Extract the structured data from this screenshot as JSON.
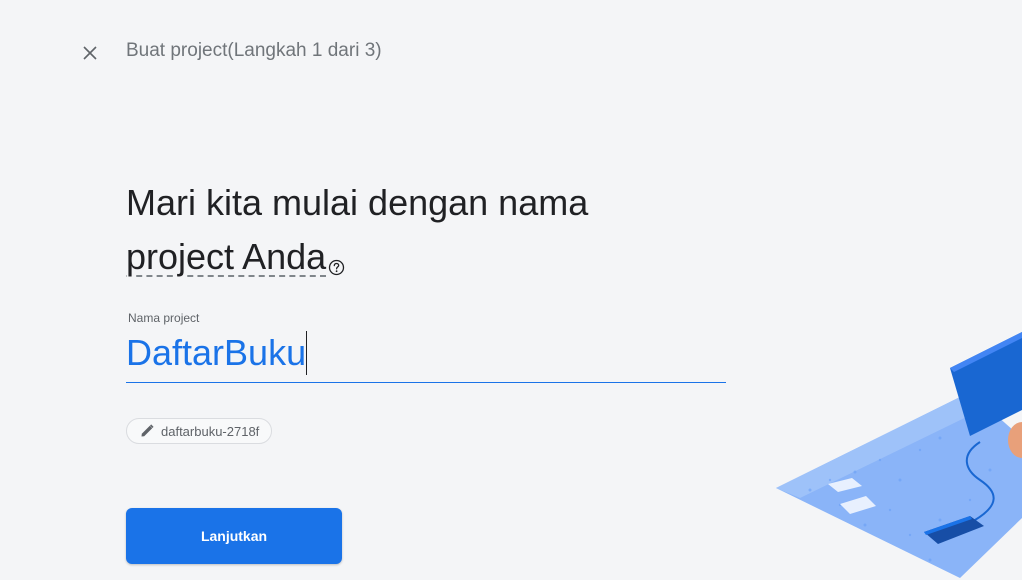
{
  "header": {
    "step_title": "Buat project(Langkah 1 dari 3)",
    "close_icon": "close-icon"
  },
  "main": {
    "headline_line1": "Mari kita mulai dengan nama",
    "headline_line2": "project Anda",
    "help_icon": "help-circle-icon"
  },
  "project_name": {
    "label": "Nama project",
    "value": "DaftarBuku"
  },
  "project_id_chip": {
    "icon": "pencil-icon",
    "label": "daftarbuku-2718f"
  },
  "actions": {
    "continue_label": "Lanjutkan"
  },
  "colors": {
    "accent": "#1a73e8",
    "background": "#f4f5f7",
    "text": "#202124",
    "muted": "#70757a"
  }
}
